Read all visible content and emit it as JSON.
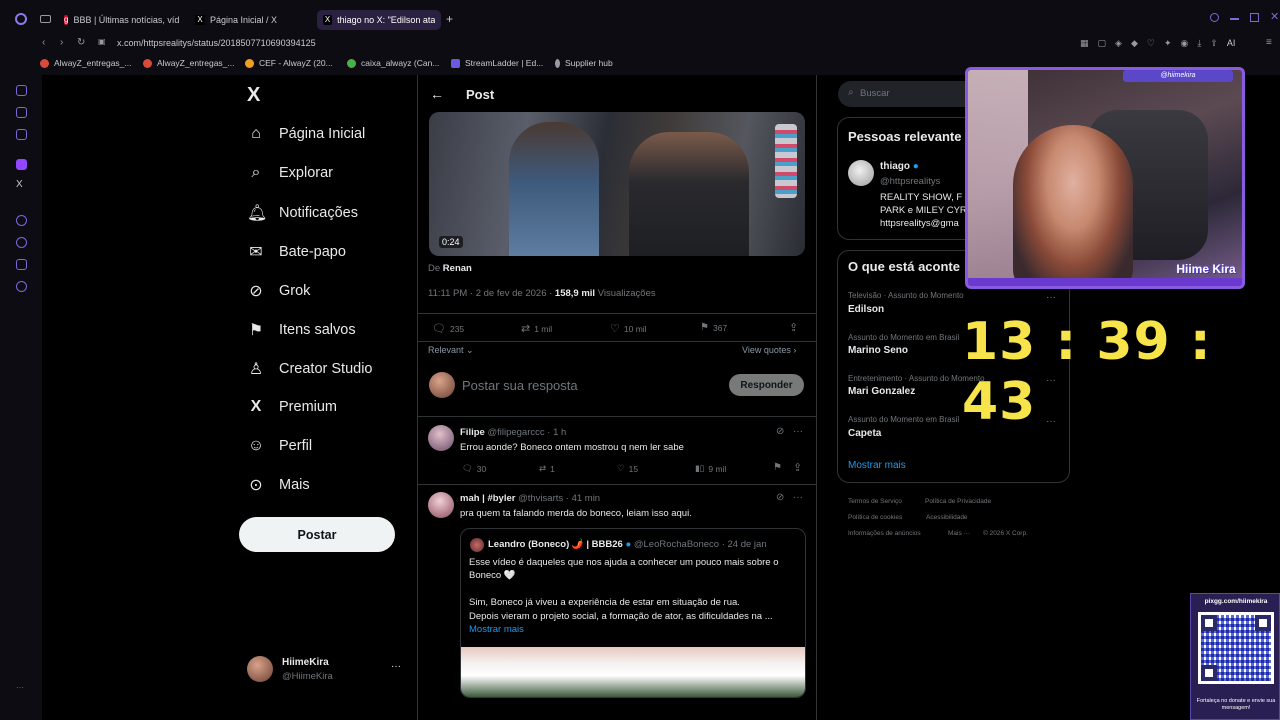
{
  "browser": {
    "tabs": [
      {
        "label": "BBB | Últimas notícias, víd",
        "icon": "g1-favicon"
      },
      {
        "label": "Página Inicial / X",
        "icon": "x-favicon"
      },
      {
        "label": "thiago no X: \"Edilson ataca",
        "icon": "x-favicon"
      }
    ],
    "new_tab": "+",
    "url": "x.com/httpsrealitys/status/2018507710690394125",
    "bookmarks": [
      {
        "label": "AlwayZ_entregas_...",
        "color": "#d94a3a"
      },
      {
        "label": "AlwayZ_entregas_...",
        "color": "#d94a3a"
      },
      {
        "label": "CEF - AlwayZ (20...",
        "color": "#f0a020"
      },
      {
        "label": "caixa_alwayz (Can...",
        "color": "#4ab04a"
      },
      {
        "label": "StreamLadder | Ed...",
        "color": "#6a5ae0"
      },
      {
        "label": "Supplier hub",
        "color": "#9a9aa6"
      }
    ],
    "extension_label": "AI"
  },
  "nav": {
    "logo": "X",
    "items": [
      {
        "label": "Página Inicial",
        "icon": "home-icon"
      },
      {
        "label": "Explorar",
        "icon": "search-icon"
      },
      {
        "label": "Notificações",
        "icon": "bell-icon"
      },
      {
        "label": "Bate-papo",
        "icon": "mail-icon"
      },
      {
        "label": "Grok",
        "icon": "grok-icon"
      },
      {
        "label": "Itens salvos",
        "icon": "bookmark-icon"
      },
      {
        "label": "Creator Studio",
        "icon": "creator-icon"
      },
      {
        "label": "Premium",
        "icon": "x-icon"
      },
      {
        "label": "Perfil",
        "icon": "person-icon"
      },
      {
        "label": "Mais",
        "icon": "more-circle-icon"
      }
    ],
    "post_button": "Postar",
    "account": {
      "name": "HiimeKira",
      "handle": "@HiimeKira",
      "more": "···"
    }
  },
  "post": {
    "header": "Post",
    "video_duration": "0:24",
    "from_label": "De",
    "from_name": "Renan",
    "timestamp": "11:11 PM · 2 de fev de 2026 · ",
    "views_count": "158,9 mil",
    "views_label": " Visualizações",
    "stats": {
      "replies": "235",
      "reposts": "1 mil",
      "likes": "10 mil",
      "bookmarks": "367"
    },
    "relevant": "Relevant",
    "view_quotes": "View quotes",
    "reply_placeholder": "Postar sua resposta",
    "reply_button": "Responder"
  },
  "replies": [
    {
      "name": "Filipe",
      "handle": "@filipegarccc",
      "time": "· 1 h",
      "text": "Errou aonde? Boneco ontem mostrou q nem ler sabe",
      "stats": {
        "replies": "30",
        "reposts": "1",
        "likes": "15",
        "views": "9 mil"
      }
    },
    {
      "name": "mah | #byler",
      "handle": "@thvisarts",
      "time": "· 41 min",
      "text": "pra quem ta falando merda do boneco, leiam isso aqui.",
      "quote": {
        "name": "Leandro (Boneco) 🌶️ | BBB26",
        "handle": "@LeoRochaBoneco",
        "time": "· 24 de jan",
        "line1": "Esse vídeo é daqueles que nos ajuda a conhecer um pouco mais sobre o Boneco 🤍",
        "line2": "Sim, Boneco já viveu a experiência de estar em situação de rua.",
        "line3": "Depois vieram o projeto social, a formação de ator, as dificuldades na ...",
        "more": "Mostrar mais"
      }
    }
  ],
  "right": {
    "search_placeholder": "Buscar",
    "people_title": "Pessoas relevante",
    "person": {
      "name": "thiago",
      "handle": "@httpsrealitys",
      "bio1": "REALITY SHOW, F",
      "bio2": "PARK e MILEY CYR",
      "bio3": "httpsrealitys@gma"
    },
    "trends_title": "O que está aconte",
    "trends": [
      {
        "category": "Televisão · Assunto do Momento",
        "name": "Edilson"
      },
      {
        "category": "Assunto do Momento em Brasil",
        "name": "Marino Seno"
      },
      {
        "category": "Entretenimento · Assunto do Momento",
        "name": "Mari Gonzalez"
      },
      {
        "category": "Assunto do Momento em Brasil",
        "name": "Capeta"
      }
    ],
    "show_more": "Mostrar mais",
    "footer": {
      "row1": [
        "Termos de Serviço",
        "Política de Privacidade"
      ],
      "row2": [
        "Política de cookies",
        "Acessibilidade"
      ],
      "row3": [
        "Informações de anúncios",
        "Mais ···",
        "© 2026 X Corp."
      ]
    }
  },
  "overlay": {
    "cam_handle": "@hiimekira",
    "cam_brand": "Hiime Kira",
    "clock": "13 : 39 : 43",
    "qr_url": "pixgg.com/hiimekira",
    "qr_caption": "Fortaleça no donate e envie sua mensagem!"
  },
  "colors": {
    "accent": "#1d9bf0",
    "clock": "#f7e44a",
    "frame": "#8a5ae0"
  }
}
